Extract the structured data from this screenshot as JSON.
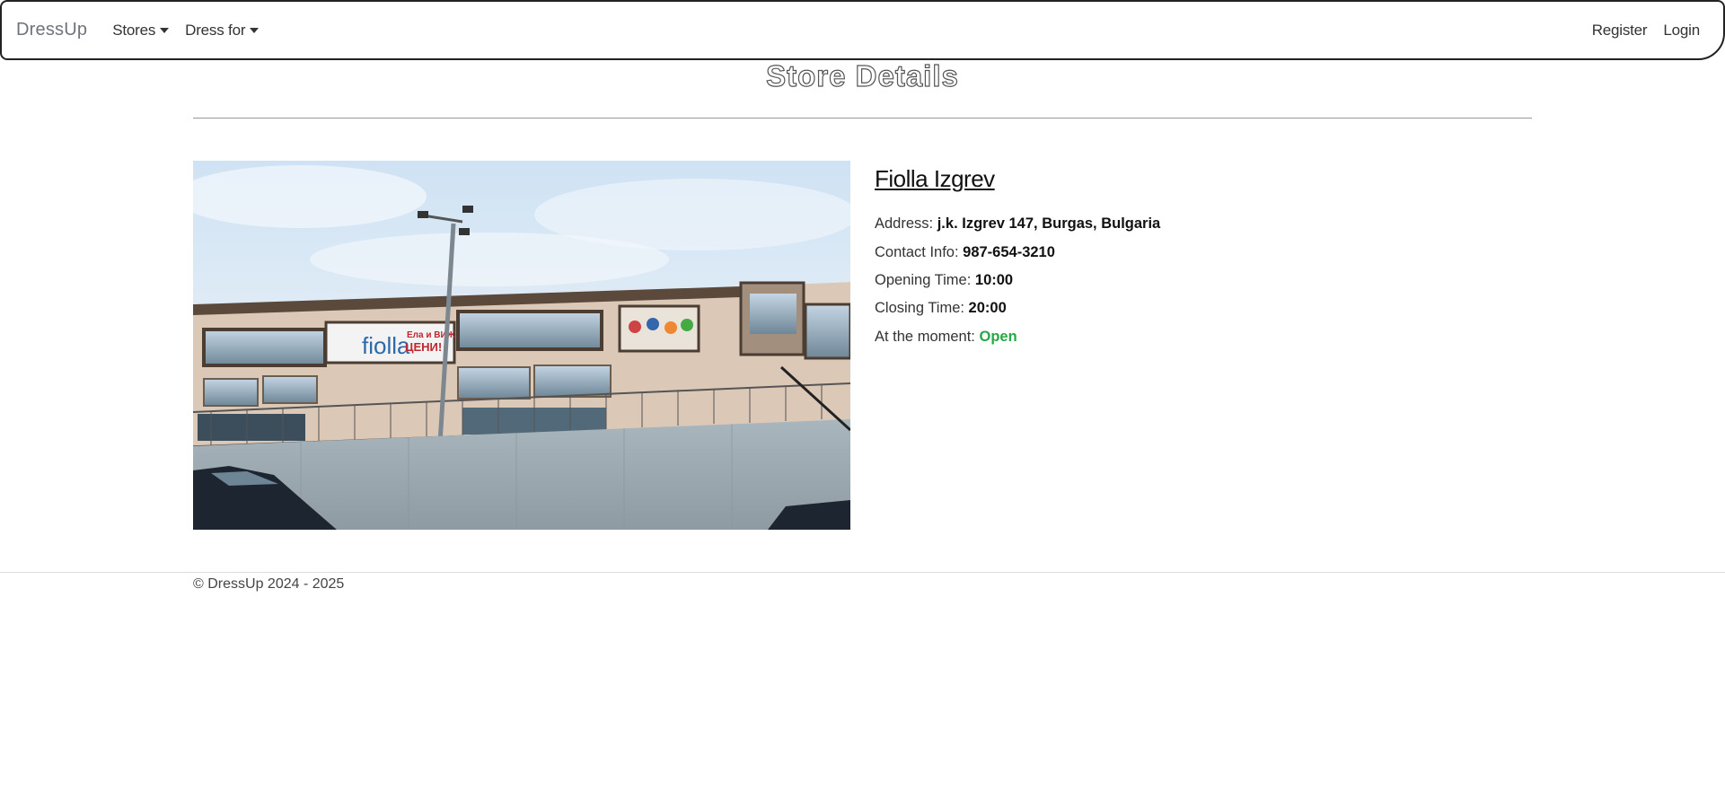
{
  "navbar": {
    "brand": "DressUp",
    "left_items": [
      {
        "label": "Stores",
        "dropdown": true
      },
      {
        "label": "Dress for",
        "dropdown": true
      }
    ],
    "right_items": [
      {
        "label": "Register"
      },
      {
        "label": "Login"
      }
    ]
  },
  "page": {
    "title": "Store Details"
  },
  "store": {
    "name": "Fiolla Izgrev",
    "address_label": "Address:",
    "address": "j.k. Izgrev 147, Burgas, Bulgaria",
    "contact_label": "Contact Info:",
    "contact": "987-654-3210",
    "opening_label": "Opening Time:",
    "opening": "10:00",
    "closing_label": "Closing Time:",
    "closing": "20:00",
    "status_label": "At the moment:",
    "status": "Open",
    "status_color": "#28a745",
    "photo_signage": {
      "logo": "fiolla",
      "banner_line1": "Ела и ВИЖ",
      "banner_line2": "ЦЕНИ!"
    }
  },
  "footer": {
    "text": "© DressUp 2024 - 2025"
  }
}
